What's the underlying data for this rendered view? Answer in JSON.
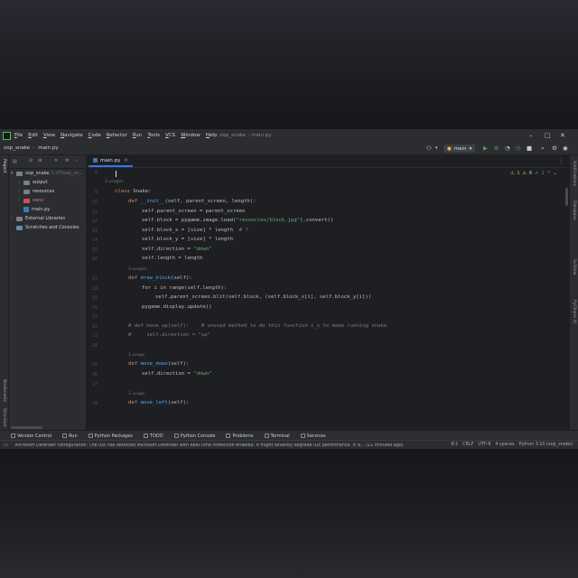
{
  "window_title": "oop_snake – main.py",
  "menu": [
    "File",
    "Edit",
    "View",
    "Navigate",
    "Code",
    "Refactor",
    "Run",
    "Tools",
    "VCS",
    "Window",
    "Help"
  ],
  "breadcrumb": {
    "project": "oop_snake",
    "file": "main.py"
  },
  "run_config": "main",
  "tab": {
    "label": "main.py"
  },
  "inspections": {
    "warnings": "1",
    "weak_warnings": "6",
    "typos": "1"
  },
  "project_panel": {
    "title": "Project",
    "tree": [
      {
        "label": "oop_snake",
        "suffix": "C:\\IT\\oop_sn..."
      },
      {
        "label": "output"
      },
      {
        "label": "resources"
      },
      {
        "label": "venv"
      },
      {
        "label": "main.py"
      },
      {
        "label": "External Libraries"
      },
      {
        "label": "Scratches and Consoles"
      }
    ]
  },
  "left_strip": [
    "Project",
    "Bookmarks",
    "Structure"
  ],
  "right_strip": [
    "Notifications",
    "Database",
    "SciView",
    "PyCharm AI"
  ],
  "editor": {
    "line_numbers": [
      "8",
      "9",
      "10",
      "11",
      "12",
      "13",
      "14",
      "15",
      "16",
      "17",
      "18",
      "19",
      "20",
      "21",
      "22",
      "23",
      "24",
      "25",
      "26",
      "27",
      "28"
    ],
    "lines": {
      "l8_usages": "2 usages",
      "l9_class": "class",
      "l9_name": "Snake:",
      "l10_def": "def",
      "l10_init": "__init__",
      "l10_args": "(self, parent_screen, length):",
      "l11": "self.parent_screen = parent_screen",
      "l12_a": "self.block = pygame.image.load(",
      "l12_s": "\"resources/block.jpg\"",
      "l12_b": ").convert()",
      "l13_a": "self.block_x = [size] * length",
      "l13_c": "# ?",
      "l14": "self.block_y = [size] * length",
      "l15_a": "self.direction = ",
      "l15_s": "\"down\"",
      "l16": "self.length = length",
      "u18": "3 usages",
      "l18_def": "def",
      "l18_fn": "draw_block",
      "l18_args": "(self):",
      "l19_for": "for i in range(self.length):",
      "l20": "self.parent_screen.blit(self.block, (self.block_x[i], self.block_y[i]))",
      "l21": "pygame.display.update()",
      "l23": "# def move_up(self):    # unused method to do this function i_s to make running snake",
      "l24": "#     self.direction = \"up\"",
      "u26": "1 usage",
      "l26_def": "def",
      "l26_fn": "move_down",
      "l26_args": "(self):",
      "l27_a": "self.direction = ",
      "l27_s": "\"down\"",
      "u28": "1 usage",
      "l28_def": "def",
      "l28_fn": "move_left",
      "l28_args": "(self):"
    }
  },
  "tool_windows": [
    "Version Control",
    "Run",
    "Python Packages",
    "TODO",
    "Python Console",
    "Problems",
    "Terminal",
    "Services"
  ],
  "status": {
    "message": "Microsoft Defender configuration: The IDE has detected Microsoft Defender with Real-Time Protection enabled. It might severely degrade IDE performance. It is... (11 minutes ago)",
    "position": "8:1",
    "line_sep": "CRLF",
    "encoding": "UTF-8",
    "indent": "4 spaces",
    "interpreter": "Python 3.10 (oop_snake)"
  }
}
